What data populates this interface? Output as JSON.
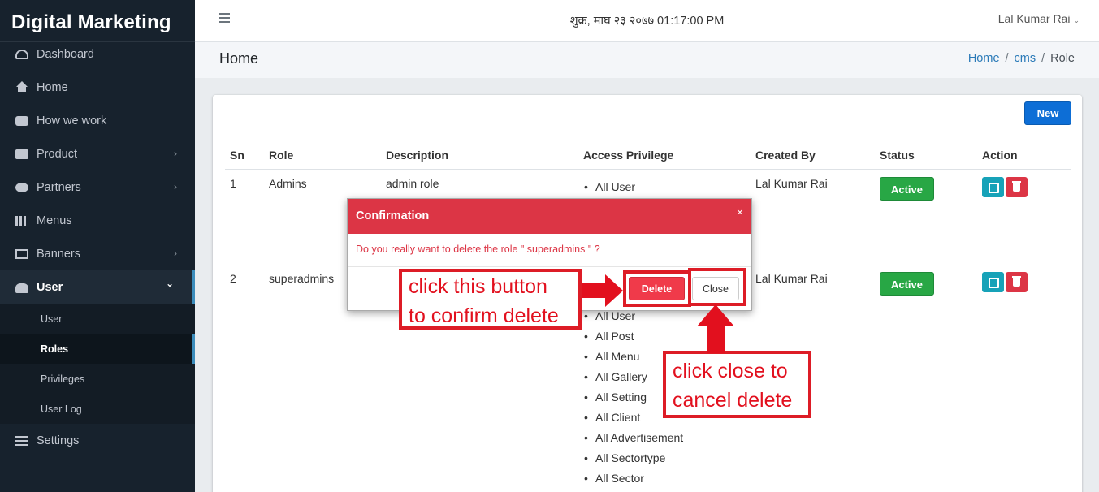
{
  "app": {
    "brand": "Digital Marketing"
  },
  "sidebar": {
    "items": [
      {
        "label": "Dashboard",
        "icon": "dashboard-icon"
      },
      {
        "label": "Home",
        "icon": "home-icon"
      },
      {
        "label": "How we work",
        "icon": "handshake-icon"
      },
      {
        "label": "Product",
        "icon": "box-icon",
        "chevron": "›"
      },
      {
        "label": "Partners",
        "icon": "user-circle-icon",
        "chevron": "›"
      },
      {
        "label": "Menus",
        "icon": "grid-icon"
      },
      {
        "label": "Banners",
        "icon": "image-icon",
        "chevron": "›"
      },
      {
        "label": "User",
        "icon": "users-icon",
        "chevron": "⌄"
      }
    ],
    "user_sub": [
      {
        "label": "User"
      },
      {
        "label": "Roles"
      },
      {
        "label": "Privileges"
      },
      {
        "label": "User Log"
      }
    ],
    "settings": {
      "label": "Settings",
      "icon": "sliders-icon"
    }
  },
  "topbar": {
    "datetime": "शुक्र, माघ २३ २०७७ 01:17:00 PM",
    "user_name": "Lal Kumar Rai",
    "user_caret": "⌄"
  },
  "header": {
    "title": "Home",
    "breadcrumb": {
      "home": "Home",
      "cms": "cms",
      "current": "Role",
      "sep": "/"
    }
  },
  "card": {
    "new_button": "New",
    "columns": [
      "Sn",
      "Role",
      "Description",
      "Access Privilege",
      "Created By",
      "Status",
      "Action"
    ],
    "rows": [
      {
        "sn": "1",
        "role": "Admins",
        "description": "admin role",
        "privileges": [
          "All User"
        ],
        "created_by": "Lal Kumar Rai",
        "status": "Active"
      },
      {
        "sn": "2",
        "role": "superadmins",
        "description": "",
        "privileges": [
          "All User",
          "All Post",
          "All Menu",
          "All Gallery",
          "All Setting",
          "All Client",
          "All Advertisement",
          "All Sectortype",
          "All Sector"
        ],
        "created_by": "Lal Kumar Rai",
        "status": "Active"
      }
    ]
  },
  "modal": {
    "title": "Confirmation",
    "close_x": "×",
    "message": "Do you really want to delete the role \" superadmins \" ?",
    "delete_label": "Delete",
    "close_label": "Close"
  },
  "annotations": {
    "left_line1": "click this button",
    "left_line2": "to confirm delete",
    "right_line1": "click close to",
    "right_line2": "cancel delete",
    "color": "#e2101e"
  },
  "colors": {
    "sidebar_bg": "#17222d",
    "primary": "#0d6ed6",
    "danger": "#dc3545",
    "success": "#28a745",
    "info": "#17a2b8"
  }
}
